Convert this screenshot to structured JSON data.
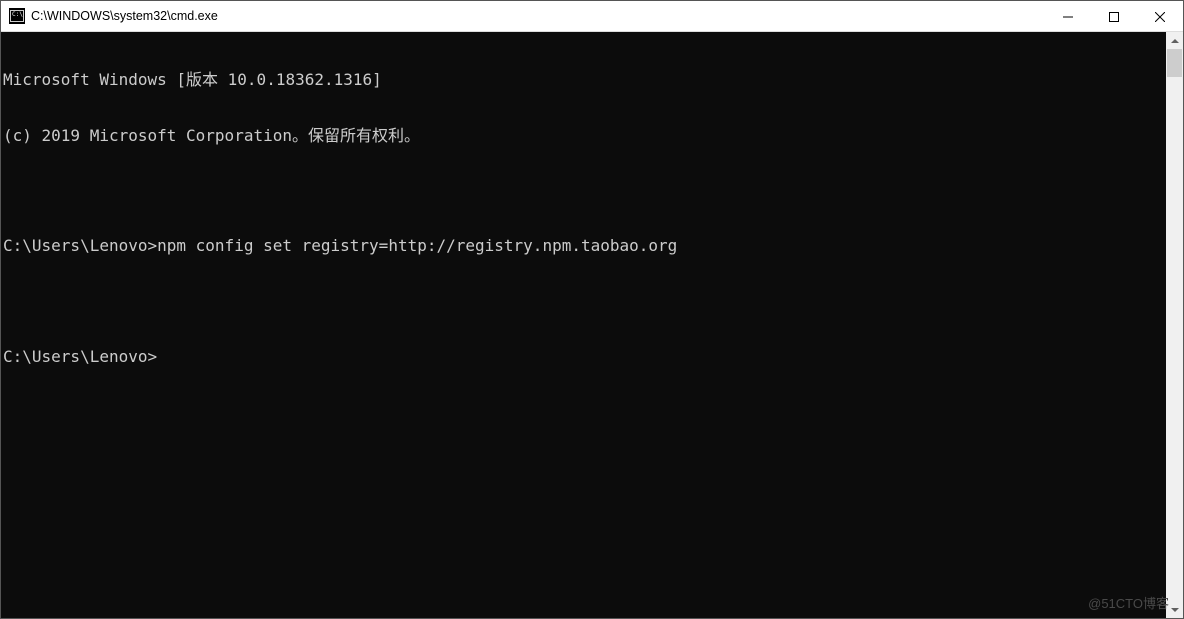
{
  "window": {
    "title": "C:\\WINDOWS\\system32\\cmd.exe"
  },
  "terminal": {
    "lines": [
      "Microsoft Windows [版本 10.0.18362.1316]",
      "(c) 2019 Microsoft Corporation。保留所有权利。",
      "",
      "C:\\Users\\Lenovo>npm config set registry=http://registry.npm.taobao.org",
      "",
      "C:\\Users\\Lenovo>"
    ]
  },
  "watermark": "@51CTO博客"
}
